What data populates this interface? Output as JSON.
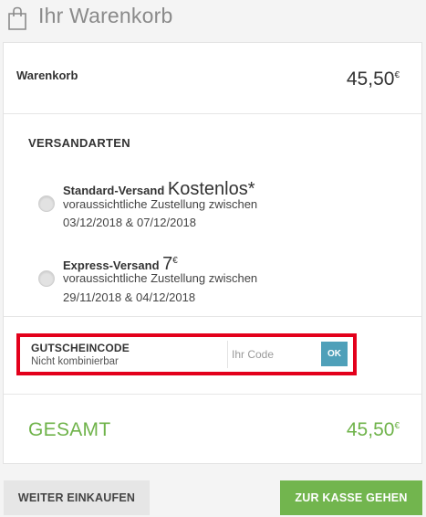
{
  "header": {
    "title": "Ihr Warenkorb",
    "icon": "shopping-bag-icon"
  },
  "cart": {
    "label": "Warenkorb",
    "price": "45,50",
    "currency": "€"
  },
  "shipping": {
    "title": "VERSANDARTEN",
    "options": [
      {
        "name": "Standard-Versand",
        "highlight": "Kostenlos*",
        "line1": "voraussichtliche Zustellung zwischen",
        "line2": "03/12/2018 & 07/12/2018"
      },
      {
        "name": "Express-Versand",
        "highlight": "7",
        "currency": "€",
        "line1": "voraussichtliche Zustellung zwischen",
        "line2": "29/11/2018 & 04/12/2018"
      }
    ]
  },
  "coupon": {
    "title": "GUTSCHEINCODE",
    "subtitle": "Nicht kombinierbar",
    "placeholder": "Ihr Code",
    "button": "OK",
    "highlight_color": "#e3001b"
  },
  "total": {
    "label": "GESAMT",
    "price": "45,50",
    "currency": "€",
    "color": "#6fb34a"
  },
  "actions": {
    "continue_label": "WEITER EINKAUFEN",
    "checkout_label": "ZUR KASSE GEHEN",
    "checkout_color": "#72b54e"
  }
}
